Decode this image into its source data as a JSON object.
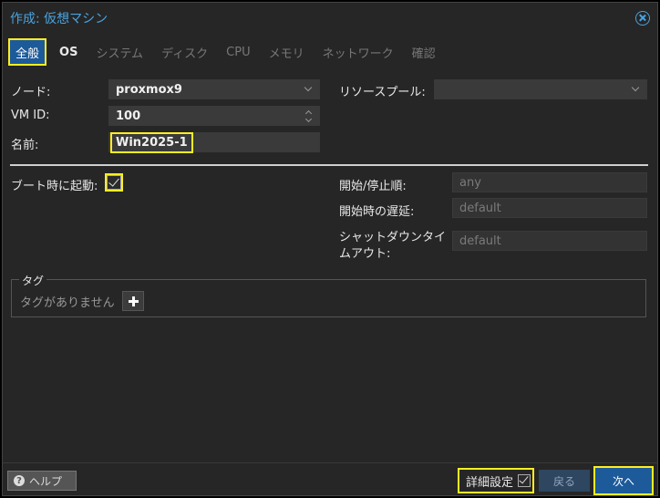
{
  "window": {
    "title": "作成: 仮想マシン"
  },
  "tabs": [
    {
      "label": "全般"
    },
    {
      "label": "OS"
    },
    {
      "label": "システム"
    },
    {
      "label": "ディスク"
    },
    {
      "label": "CPU"
    },
    {
      "label": "メモリ"
    },
    {
      "label": "ネットワーク"
    },
    {
      "label": "確認"
    }
  ],
  "form": {
    "node": {
      "label": "ノード:",
      "value": "proxmox9"
    },
    "vmid": {
      "label": "VM ID:",
      "value": "100"
    },
    "name": {
      "label": "名前:",
      "value": "Win2025-1"
    },
    "resource_pool": {
      "label": "リソースプール:",
      "value": ""
    },
    "start_at_boot": {
      "label": "ブート時に起動:",
      "checked": true
    },
    "start_order": {
      "label": "開始/停止順:",
      "placeholder": "any"
    },
    "startup_delay": {
      "label": "開始時の遅延:",
      "placeholder": "default"
    },
    "shutdown_timeout": {
      "label_line1": "シャットダウンタイ",
      "label_line2": "ムアウト:",
      "placeholder": "default"
    }
  },
  "tags": {
    "legend": "タグ",
    "empty_text": "タグがありません"
  },
  "footer": {
    "help_label": "ヘルプ",
    "advanced_label": "詳細設定",
    "advanced_checked": true,
    "back_label": "戻る",
    "next_label": "次へ"
  },
  "colors": {
    "accent": "#1c5a9a",
    "highlight": "#ffee22",
    "title": "#4aa3df"
  }
}
